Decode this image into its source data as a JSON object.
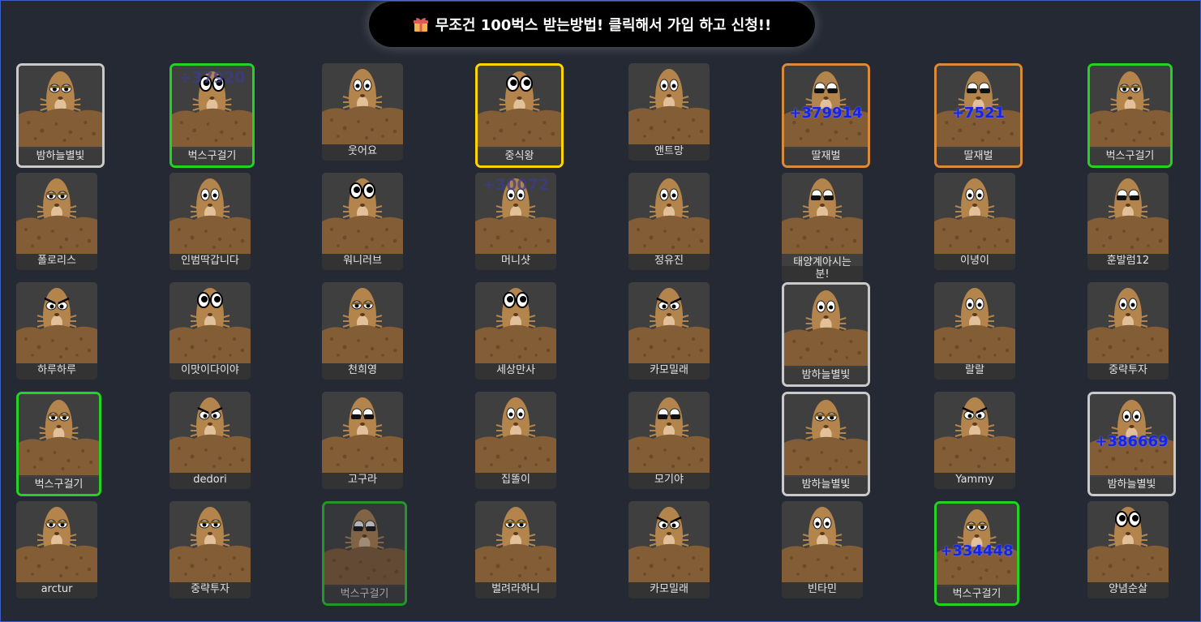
{
  "banner": {
    "text": "무조건 100벅스 받는방법! 클릭해서 가입 하고 신청!!",
    "icon": "gift-icon"
  },
  "colors": {
    "background": "#252933",
    "card": "#3f3f3f",
    "score": "#1326e8"
  },
  "players": [
    {
      "name": "밤하늘별빛",
      "border": "gray",
      "eyes": "sleepy"
    },
    {
      "name": "벅스구걸기",
      "border": "green",
      "eyes": "big",
      "faded_score": "+37920"
    },
    {
      "name": "웃어요",
      "border": "none",
      "eyes": "normal"
    },
    {
      "name": "중식왕",
      "border": "gold",
      "eyes": "big"
    },
    {
      "name": "앤트망",
      "border": "none",
      "eyes": "normal"
    },
    {
      "name": "딸재벌",
      "border": "orange",
      "eyes": "shades",
      "score": "+379914"
    },
    {
      "name": "딸재벌",
      "border": "orange",
      "eyes": "shades",
      "score": "+7521"
    },
    {
      "name": "벅스구걸기",
      "border": "green",
      "eyes": "sleepy"
    },
    {
      "name": "폴로리스",
      "border": "none",
      "eyes": "sleepy"
    },
    {
      "name": "인범딱갑니다",
      "border": "none",
      "eyes": "normal"
    },
    {
      "name": "워니러브",
      "border": "none",
      "eyes": "big"
    },
    {
      "name": "머니샷",
      "border": "none",
      "eyes": "normal",
      "faded_score": "+30072"
    },
    {
      "name": "정유진",
      "border": "none",
      "eyes": "normal"
    },
    {
      "name": "태양계아시는 분!",
      "border": "none",
      "eyes": "shades"
    },
    {
      "name": "이녕이",
      "border": "none",
      "eyes": "normal"
    },
    {
      "name": "훈발럼12",
      "border": "none",
      "eyes": "shades"
    },
    {
      "name": "하루하루",
      "border": "none",
      "eyes": "angry"
    },
    {
      "name": "이맛이다이야",
      "border": "none",
      "eyes": "big"
    },
    {
      "name": "천희영",
      "border": "none",
      "eyes": "sleepy"
    },
    {
      "name": "세상만사",
      "border": "none",
      "eyes": "big"
    },
    {
      "name": "카모밀래",
      "border": "none",
      "eyes": "angry"
    },
    {
      "name": "밤하늘별빛",
      "border": "gray",
      "eyes": "normal"
    },
    {
      "name": "랄랄",
      "border": "none",
      "eyes": "normal"
    },
    {
      "name": "중략투자",
      "border": "none",
      "eyes": "normal"
    },
    {
      "name": "벅스구걸기",
      "border": "green",
      "eyes": "sleepy"
    },
    {
      "name": "dedori",
      "border": "none",
      "eyes": "angry"
    },
    {
      "name": "고구라",
      "border": "none",
      "eyes": "shades"
    },
    {
      "name": "집똘이",
      "border": "none",
      "eyes": "normal"
    },
    {
      "name": "모기야",
      "border": "none",
      "eyes": "shades"
    },
    {
      "name": "밤하늘별빛",
      "border": "gray",
      "eyes": "sleepy"
    },
    {
      "name": "Yammy",
      "border": "none",
      "eyes": "angry"
    },
    {
      "name": "밤하늘별빛",
      "border": "gray",
      "eyes": "normal",
      "score": "+386669"
    },
    {
      "name": "arctur",
      "border": "none",
      "eyes": "sleepy"
    },
    {
      "name": "중략투자",
      "border": "none",
      "eyes": "sleepy"
    },
    {
      "name": "벅스구걸기",
      "border": "green",
      "eyes": "shades",
      "dim": true
    },
    {
      "name": "벌려라하니",
      "border": "none",
      "eyes": "sleepy"
    },
    {
      "name": "카모밀래",
      "border": "none",
      "eyes": "angry"
    },
    {
      "name": "빈타민",
      "border": "none",
      "eyes": "normal"
    },
    {
      "name": "벅스구걸기",
      "border": "green",
      "eyes": "sleepy",
      "score": "+334448"
    },
    {
      "name": "양념순살",
      "border": "none",
      "eyes": "big"
    }
  ]
}
